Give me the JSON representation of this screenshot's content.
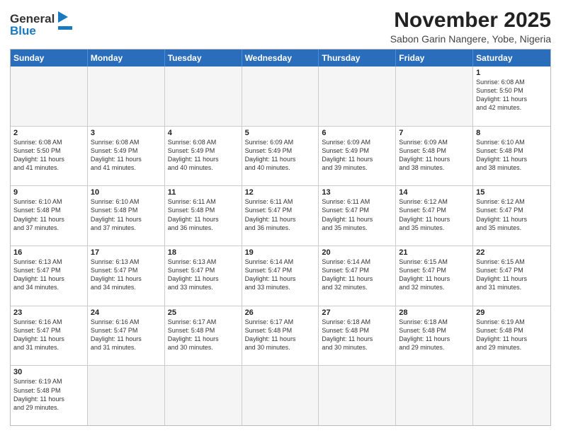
{
  "header": {
    "logo_general": "General",
    "logo_blue": "Blue",
    "title": "November 2025",
    "location": "Sabon Garin Nangere, Yobe, Nigeria"
  },
  "weekdays": [
    "Sunday",
    "Monday",
    "Tuesday",
    "Wednesday",
    "Thursday",
    "Friday",
    "Saturday"
  ],
  "weeks": [
    [
      {
        "num": "",
        "info": ""
      },
      {
        "num": "",
        "info": ""
      },
      {
        "num": "",
        "info": ""
      },
      {
        "num": "",
        "info": ""
      },
      {
        "num": "",
        "info": ""
      },
      {
        "num": "",
        "info": ""
      },
      {
        "num": "1",
        "info": "Sunrise: 6:08 AM\nSunset: 5:50 PM\nDaylight: 11 hours\nand 42 minutes."
      }
    ],
    [
      {
        "num": "2",
        "info": "Sunrise: 6:08 AM\nSunset: 5:50 PM\nDaylight: 11 hours\nand 41 minutes."
      },
      {
        "num": "3",
        "info": "Sunrise: 6:08 AM\nSunset: 5:49 PM\nDaylight: 11 hours\nand 41 minutes."
      },
      {
        "num": "4",
        "info": "Sunrise: 6:08 AM\nSunset: 5:49 PM\nDaylight: 11 hours\nand 40 minutes."
      },
      {
        "num": "5",
        "info": "Sunrise: 6:09 AM\nSunset: 5:49 PM\nDaylight: 11 hours\nand 40 minutes."
      },
      {
        "num": "6",
        "info": "Sunrise: 6:09 AM\nSunset: 5:49 PM\nDaylight: 11 hours\nand 39 minutes."
      },
      {
        "num": "7",
        "info": "Sunrise: 6:09 AM\nSunset: 5:48 PM\nDaylight: 11 hours\nand 38 minutes."
      },
      {
        "num": "8",
        "info": "Sunrise: 6:10 AM\nSunset: 5:48 PM\nDaylight: 11 hours\nand 38 minutes."
      }
    ],
    [
      {
        "num": "9",
        "info": "Sunrise: 6:10 AM\nSunset: 5:48 PM\nDaylight: 11 hours\nand 37 minutes."
      },
      {
        "num": "10",
        "info": "Sunrise: 6:10 AM\nSunset: 5:48 PM\nDaylight: 11 hours\nand 37 minutes."
      },
      {
        "num": "11",
        "info": "Sunrise: 6:11 AM\nSunset: 5:48 PM\nDaylight: 11 hours\nand 36 minutes."
      },
      {
        "num": "12",
        "info": "Sunrise: 6:11 AM\nSunset: 5:47 PM\nDaylight: 11 hours\nand 36 minutes."
      },
      {
        "num": "13",
        "info": "Sunrise: 6:11 AM\nSunset: 5:47 PM\nDaylight: 11 hours\nand 35 minutes."
      },
      {
        "num": "14",
        "info": "Sunrise: 6:12 AM\nSunset: 5:47 PM\nDaylight: 11 hours\nand 35 minutes."
      },
      {
        "num": "15",
        "info": "Sunrise: 6:12 AM\nSunset: 5:47 PM\nDaylight: 11 hours\nand 35 minutes."
      }
    ],
    [
      {
        "num": "16",
        "info": "Sunrise: 6:13 AM\nSunset: 5:47 PM\nDaylight: 11 hours\nand 34 minutes."
      },
      {
        "num": "17",
        "info": "Sunrise: 6:13 AM\nSunset: 5:47 PM\nDaylight: 11 hours\nand 34 minutes."
      },
      {
        "num": "18",
        "info": "Sunrise: 6:13 AM\nSunset: 5:47 PM\nDaylight: 11 hours\nand 33 minutes."
      },
      {
        "num": "19",
        "info": "Sunrise: 6:14 AM\nSunset: 5:47 PM\nDaylight: 11 hours\nand 33 minutes."
      },
      {
        "num": "20",
        "info": "Sunrise: 6:14 AM\nSunset: 5:47 PM\nDaylight: 11 hours\nand 32 minutes."
      },
      {
        "num": "21",
        "info": "Sunrise: 6:15 AM\nSunset: 5:47 PM\nDaylight: 11 hours\nand 32 minutes."
      },
      {
        "num": "22",
        "info": "Sunrise: 6:15 AM\nSunset: 5:47 PM\nDaylight: 11 hours\nand 31 minutes."
      }
    ],
    [
      {
        "num": "23",
        "info": "Sunrise: 6:16 AM\nSunset: 5:47 PM\nDaylight: 11 hours\nand 31 minutes."
      },
      {
        "num": "24",
        "info": "Sunrise: 6:16 AM\nSunset: 5:47 PM\nDaylight: 11 hours\nand 31 minutes."
      },
      {
        "num": "25",
        "info": "Sunrise: 6:17 AM\nSunset: 5:48 PM\nDaylight: 11 hours\nand 30 minutes."
      },
      {
        "num": "26",
        "info": "Sunrise: 6:17 AM\nSunset: 5:48 PM\nDaylight: 11 hours\nand 30 minutes."
      },
      {
        "num": "27",
        "info": "Sunrise: 6:18 AM\nSunset: 5:48 PM\nDaylight: 11 hours\nand 30 minutes."
      },
      {
        "num": "28",
        "info": "Sunrise: 6:18 AM\nSunset: 5:48 PM\nDaylight: 11 hours\nand 29 minutes."
      },
      {
        "num": "29",
        "info": "Sunrise: 6:19 AM\nSunset: 5:48 PM\nDaylight: 11 hours\nand 29 minutes."
      }
    ],
    [
      {
        "num": "30",
        "info": "Sunrise: 6:19 AM\nSunset: 5:48 PM\nDaylight: 11 hours\nand 29 minutes."
      },
      {
        "num": "",
        "info": ""
      },
      {
        "num": "",
        "info": ""
      },
      {
        "num": "",
        "info": ""
      },
      {
        "num": "",
        "info": ""
      },
      {
        "num": "",
        "info": ""
      },
      {
        "num": "",
        "info": ""
      }
    ]
  ]
}
